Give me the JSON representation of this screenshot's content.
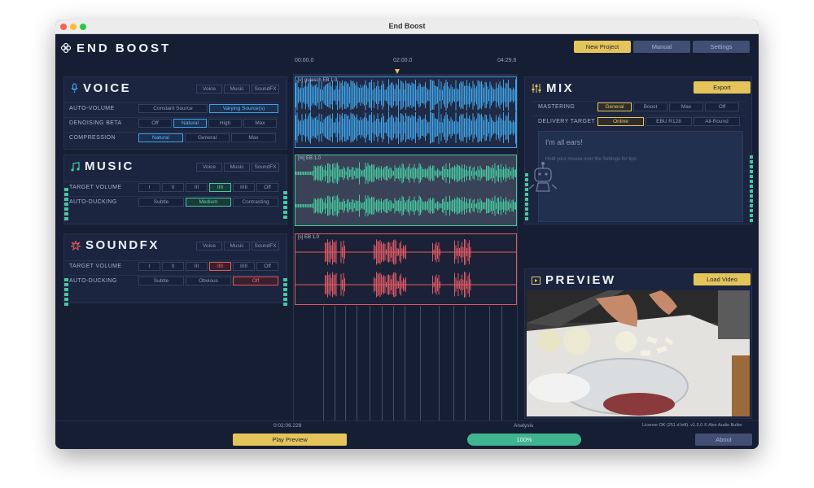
{
  "window": {
    "title": "End Boost"
  },
  "app": {
    "brand": "END BOOST",
    "logo_icon": "flower-logo-icon"
  },
  "header": {
    "new_project": "New Project",
    "manual": "Manual",
    "settings": "Settings"
  },
  "timeline": {
    "start": "00:00.0",
    "mid": "02:00.0",
    "end": "04:29.6"
  },
  "voice": {
    "title": "VOICE",
    "icon": "microphone-icon",
    "tabs": [
      "Voice",
      "Music",
      "SoundFX"
    ],
    "rows": [
      {
        "label": "AUTO-VOLUME",
        "options": [
          "Constant Source",
          "Varying Source(s)"
        ],
        "selected": 1
      },
      {
        "label": "DENOISING BETA",
        "options": [
          "Off",
          "Natural",
          "High",
          "Max"
        ],
        "selected": 1
      },
      {
        "label": "COMPRESSION",
        "options": [
          "Natural",
          "General",
          "Max"
        ],
        "selected": 0
      }
    ],
    "track_label": "[v] gulasch EB 1.0",
    "color": "#3fa3e6"
  },
  "music": {
    "title": "MUSIC",
    "icon": "music-note-icon",
    "tabs": [
      "Voice",
      "Music",
      "SoundFX"
    ],
    "rows": [
      {
        "label": "TARGET VOLUME",
        "options": [
          "I",
          "II",
          "III",
          "IIII",
          "IIIII",
          "Off"
        ],
        "selected": 3
      },
      {
        "label": "AUTO-DUCKING",
        "options": [
          "Subtle",
          "Medium",
          "Contrasting"
        ],
        "selected": 1
      }
    ],
    "track_label": "[m] EB 1.0",
    "color": "#45c9a0"
  },
  "soundfx": {
    "title": "SOUNDFX",
    "icon": "burst-icon",
    "tabs": [
      "Voice",
      "Music",
      "SoundFX"
    ],
    "rows": [
      {
        "label": "TARGET VOLUME",
        "options": [
          "I",
          "II",
          "III",
          "IIII",
          "IIIII",
          "Off"
        ],
        "selected": 3
      },
      {
        "label": "AUTO-DUCKING",
        "options": [
          "Subtle",
          "Obvious",
          "Off"
        ],
        "selected": 2
      }
    ],
    "track_label": "[s] EB 1.0",
    "color": "#e05a63"
  },
  "mix": {
    "title": "MIX",
    "icon": "sliders-icon",
    "export": "Export",
    "rows": [
      {
        "label": "MASTERING",
        "options": [
          "General",
          "Boost",
          "Max",
          "Off"
        ],
        "selected": 0
      },
      {
        "label": "DELIVERY TARGET",
        "options": [
          "Online",
          "EBU R128",
          "All-Round"
        ],
        "selected": 0
      }
    ],
    "assistant_title": "I'm all ears!",
    "assistant_hint": "Hold your mouse over the Settings for tips",
    "robot_icon": "robot-icon"
  },
  "preview": {
    "title": "PREVIEW",
    "icon": "play-square-icon",
    "load_video": "Load Video"
  },
  "footer": {
    "time": "0:02:06.228",
    "play": "Play Preview",
    "analysis_label": "Analysis",
    "analysis_value": "100%",
    "analysis_progress": 1.0,
    "license": "License OK (251 d left). v1.5.0 © Alex Audio Butler",
    "about": "About"
  }
}
